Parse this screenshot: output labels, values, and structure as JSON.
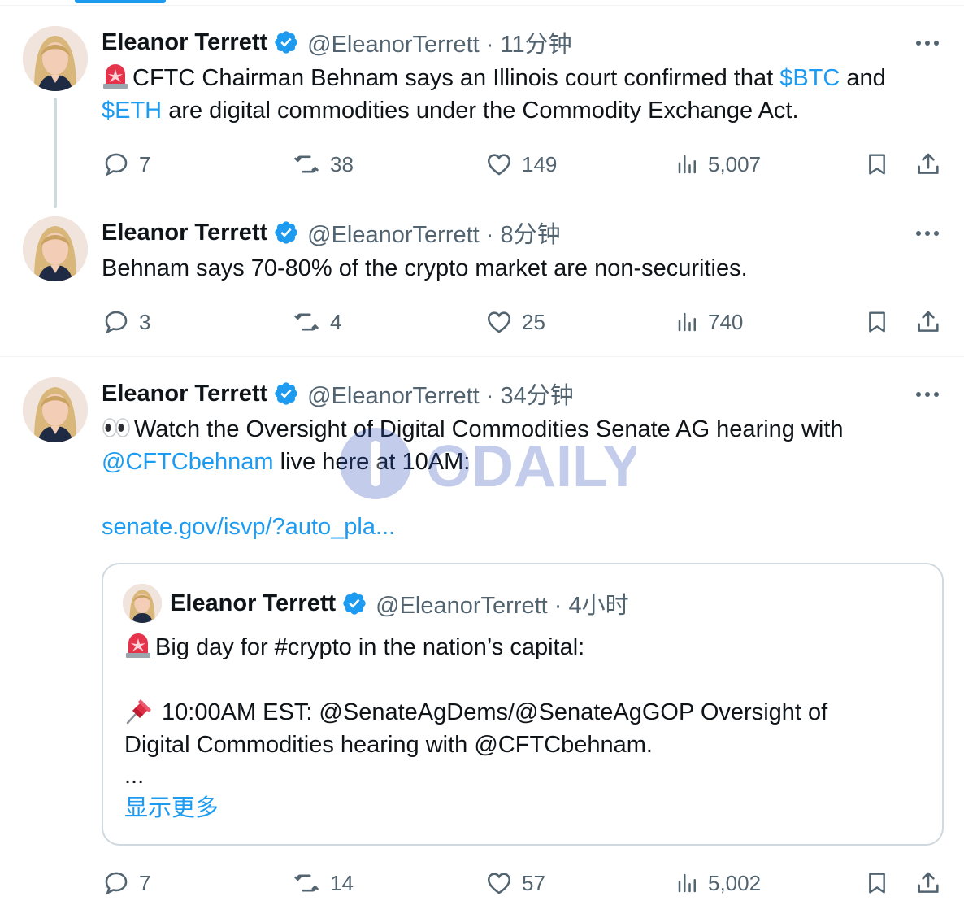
{
  "colors": {
    "accent": "#1d9bf0",
    "text": "#0f1419",
    "muted": "#536471",
    "border": "#cfd9de"
  },
  "tweets": [
    {
      "author_name": "Eleanor Terrett",
      "handle_time": "@EleanorTerrett · 11分钟",
      "text_parts": [
        "CFTC Chairman Behnam says an Illinois court confirmed that ",
        "$BTC",
        " and ",
        "$ETH",
        " are digital commodities under the Commodity Exchange Act."
      ],
      "replies": "7",
      "reposts": "38",
      "likes": "149",
      "views": "5,007"
    },
    {
      "author_name": "Eleanor Terrett",
      "handle_time": "@EleanorTerrett · 8分钟",
      "text": "Behnam says 70-80% of the crypto market are non-securities.",
      "replies": "3",
      "reposts": "4",
      "likes": "25",
      "views": "740"
    },
    {
      "author_name": "Eleanor Terrett",
      "handle_time": "@EleanorTerrett · 34分钟",
      "text_parts": [
        "Watch the Oversight of Digital Commodities Senate AG hearing with",
        "@CFTCbehnam",
        " live here at 10AM:"
      ],
      "link": "senate.gov/isvp/?auto_pla...",
      "replies": "7",
      "reposts": "14",
      "likes": "57",
      "views": "5,002",
      "quote": {
        "author_name": "Eleanor Terrett",
        "handle_time": "@EleanorTerrett · 4小时",
        "line1": "Big day for #crypto in the nation’s capital:",
        "line2": "10:00AM EST: @SenateAgDems/@SenateAgGOP Oversight of",
        "line3": "Digital Commodities hearing with @CFTCbehnam.",
        "line4": "...",
        "show_more": "显示更多"
      }
    }
  ],
  "watermark": "ODAILY",
  "icons": [
    "more-icon",
    "verified-icon",
    "reply-icon",
    "repost-icon",
    "like-icon",
    "views-icon",
    "bookmark-icon",
    "share-icon",
    "siren-emoji",
    "eyes-emoji",
    "pushpin-emoji"
  ]
}
